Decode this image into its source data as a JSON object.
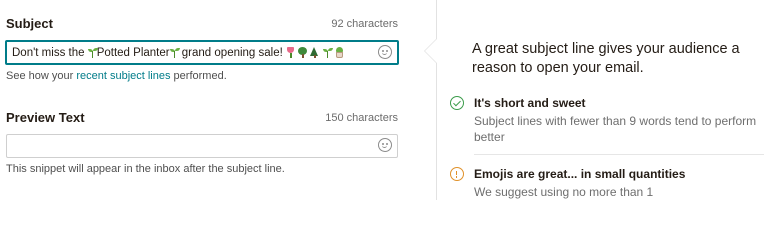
{
  "subject": {
    "label": "Subject",
    "count": "92 characters",
    "value_prefix": "Don't miss the ",
    "value_brand": "Potted Planter",
    "value_suffix": " grand opening sale! ",
    "emoji_button_icon": "smiley-icon",
    "helper_prefix": "See how your ",
    "helper_link": "recent subject lines",
    "helper_suffix": " performed."
  },
  "preview": {
    "label": "Preview Text",
    "count": "150 characters",
    "value": "",
    "emoji_button_icon": "smiley-icon",
    "helper": "This snippet will appear in the inbox after the subject line."
  },
  "tips": {
    "intro": "A great subject line gives your audience a reason to open your email.",
    "items": [
      {
        "icon": "check-circle-icon",
        "title": "It's short and sweet",
        "body": "Subject lines with fewer than 9 words tend to perform better"
      },
      {
        "icon": "warning-circle-icon",
        "title": "Emojis are great... in small quantities",
        "body": "We suggest using no more than 1"
      }
    ]
  },
  "colors": {
    "accent": "#007c89",
    "success": "#3b9c4b",
    "warning": "#e0912a",
    "text": "#241c15"
  }
}
